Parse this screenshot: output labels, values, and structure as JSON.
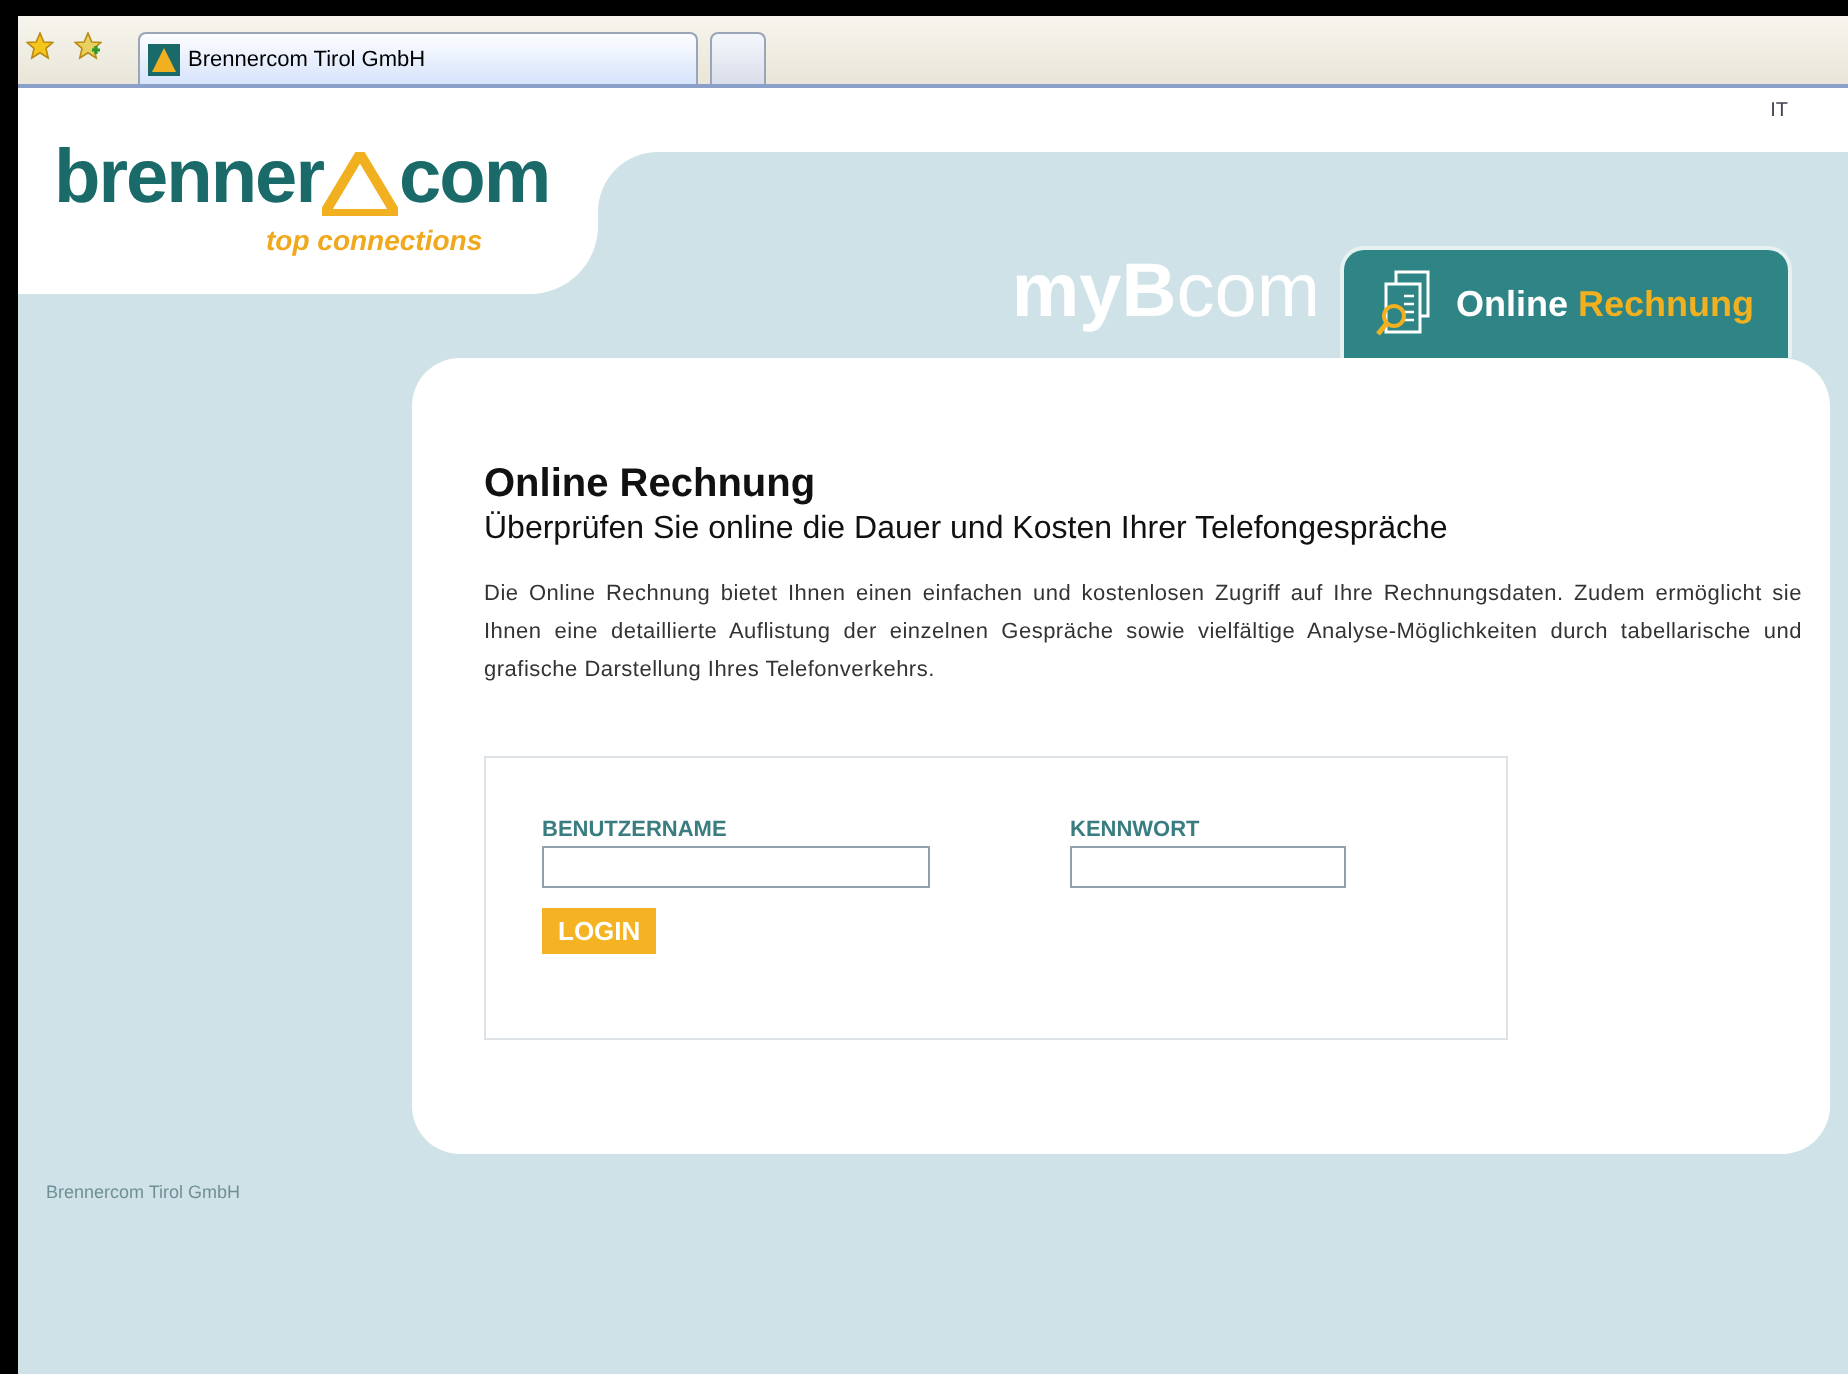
{
  "browser": {
    "tabs": [
      {
        "title": "Brennercom Tirol GmbH",
        "selected": true
      },
      {
        "selected": false
      }
    ]
  },
  "header": {
    "logo": {
      "name_start": "brenner",
      "name_end": "com",
      "tagline": "top connections"
    },
    "language_link": "IT",
    "brand": {
      "bold": "myB",
      "light": "com"
    },
    "section_badge": {
      "first": "Online",
      "second": "Rechnung"
    }
  },
  "content": {
    "title": "Online Rechnung",
    "subtitle": "Überprüfen Sie online die Dauer und Kosten Ihrer Telefongespräche",
    "description": "Die Online Rechnung bietet Ihnen einen einfachen und kostenlosen Zugriff auf Ihre Rechnungsdaten. Zudem ermöglicht sie Ihnen eine detaillierte Auflistung der einzelnen Gespräche sowie vielfältige Analyse-Möglichkeiten durch tabellarische und grafische Darstellung Ihres Telefonverkehrs.",
    "login": {
      "fields": [
        {
          "label": "BENUTZERNAME",
          "kind": "text"
        },
        {
          "label": "KENNWORT",
          "kind": "password"
        }
      ],
      "button": "LOGIN"
    }
  },
  "footer": "Brennercom Tirol GmbH"
}
